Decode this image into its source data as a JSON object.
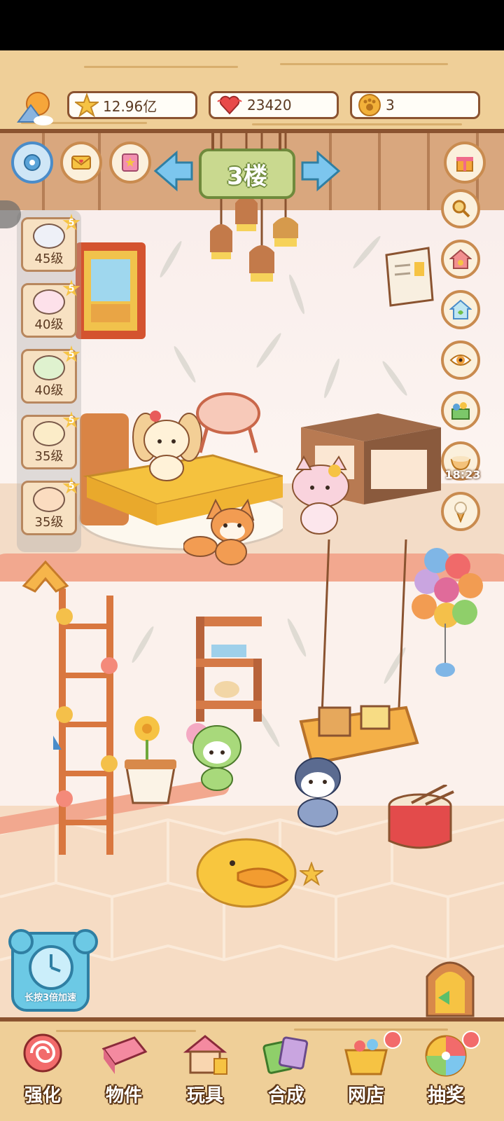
{
  "resources": {
    "stars": "12.96亿",
    "hearts": "23420",
    "coins": "3"
  },
  "floor": {
    "label": "3楼"
  },
  "pets": [
    {
      "level": "45级",
      "badge": "5",
      "color": "#8a90a8"
    },
    {
      "level": "40级",
      "badge": "5",
      "color": "#f4a9c3"
    },
    {
      "level": "40级",
      "badge": "5",
      "color": "#8fcf6a"
    },
    {
      "level": "35级",
      "badge": "5",
      "color": "#f0c77a"
    },
    {
      "level": "35级",
      "badge": "5",
      "color": "#f29c52"
    }
  ],
  "right_buttons": [
    {
      "icon": "magnifier-icon"
    },
    {
      "icon": "paw-house-icon"
    },
    {
      "icon": "green-house-icon"
    },
    {
      "icon": "eye-icon"
    },
    {
      "icon": "treasure-box-icon"
    },
    {
      "icon": "noodle-bowl-icon"
    },
    {
      "icon": "ice-cream-icon"
    }
  ],
  "timer": "18:23",
  "speed_up": {
    "label": "长按3倍加速"
  },
  "nav": [
    {
      "label": "强化",
      "icon": "lollipop-icon"
    },
    {
      "label": "物件",
      "icon": "piano-icon"
    },
    {
      "label": "玩具",
      "icon": "toy-house-icon"
    },
    {
      "label": "合成",
      "icon": "cards-icon"
    },
    {
      "label": "网店",
      "icon": "basket-icon"
    },
    {
      "label": "抽奖",
      "icon": "wheel-icon"
    }
  ],
  "colors": {
    "wood": "#efcf98",
    "wood_dark": "#8a5330",
    "floor_sign": "#c9d98f",
    "accent_blue": "#6cc9e5"
  }
}
